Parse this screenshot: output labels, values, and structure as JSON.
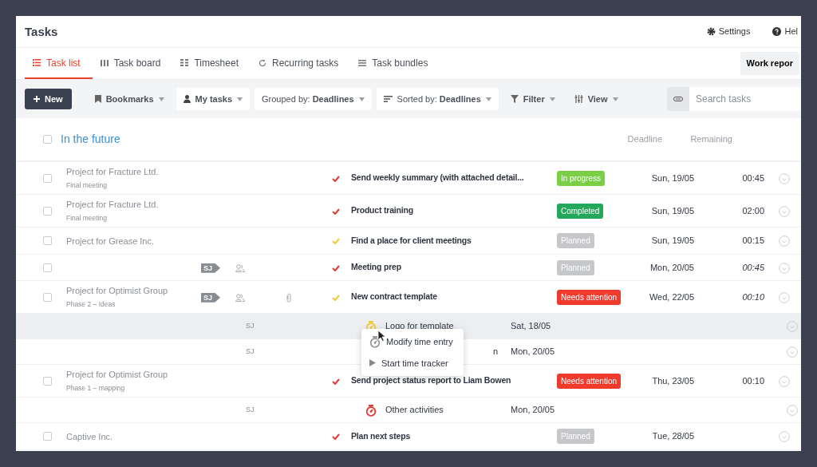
{
  "title": "Tasks",
  "header_links": [
    "Settings",
    "Hel"
  ],
  "tabs": [
    {
      "label": "Task list",
      "selected": true
    },
    {
      "label": "Task board",
      "selected": false
    },
    {
      "label": "Timesheet",
      "selected": false
    },
    {
      "label": "Recurring tasks",
      "selected": false
    },
    {
      "label": "Task bundles",
      "selected": false
    }
  ],
  "work_report_button": "Work repor",
  "toolbar": {
    "new_button": "New",
    "bookmarks": "Bookmarks",
    "my_tasks": "My tasks",
    "grouped_by": {
      "label": "Grouped by:",
      "value": "Deadlines"
    },
    "sorted_by": {
      "label": "Sorted by:",
      "value": "Deadlines"
    },
    "filter": "Filter",
    "view": "View",
    "search": {
      "placeholder": "Search tasks"
    }
  },
  "group": {
    "title": "In the future",
    "checked": false,
    "columns": [
      "Deadline",
      "Remaining"
    ]
  },
  "rows": [
    {
      "kind": "task",
      "checked": false,
      "project": "Project for Fracture Ltd.",
      "phase": "Final meeting",
      "shared": false,
      "attachment": false,
      "color": "#e53935",
      "title": "Send weekly summary (with attached detail...",
      "status": {
        "label": "In progress",
        "color": "#7bcf47"
      },
      "deadline": "Sun, 19/05",
      "remaining": "00:45",
      "estimated": false
    },
    {
      "kind": "task",
      "checked": false,
      "project": "Project for Fracture Ltd.",
      "phase": "Final meeting",
      "shared": false,
      "attachment": false,
      "color": "#e53935",
      "title": "Product training",
      "status": {
        "label": "Completed",
        "color": "#22a75b"
      },
      "deadline": "Sun, 19/05",
      "remaining": "02:00",
      "estimated": false
    },
    {
      "kind": "task",
      "checked": false,
      "project": "Project for Grease Inc.",
      "shared": false,
      "attachment": false,
      "color": "#f2c936",
      "title": "Find a place for client meetings",
      "status": {
        "label": "Planned",
        "color": "#c5c7cb"
      },
      "deadline": "Sun, 19/05",
      "remaining": "00:15",
      "estimated": false
    },
    {
      "kind": "task",
      "checked": false,
      "assignee": "SJ",
      "shared": true,
      "attachment": false,
      "color": "#e53935",
      "title": "Meeting prep",
      "status": {
        "label": "Planned",
        "color": "#c5c7cb"
      },
      "deadline": "Mon, 20/05",
      "remaining": "00:45",
      "estimated": true
    },
    {
      "kind": "task",
      "checked": false,
      "project": "Project for Optimist Group",
      "phase": "Phase 2 – Ideas",
      "assignee": "SJ",
      "shared": true,
      "attachment": true,
      "color": "#f2c936",
      "title": "New contract template",
      "status": {
        "label": "Needs attention",
        "color": "#f03a2c"
      },
      "deadline": "Wed, 22/05",
      "remaining": "00:10",
      "estimated": true
    },
    {
      "kind": "time_entry",
      "highlighted": true,
      "assignee": "SJ",
      "color": "#f2c936",
      "task": "Logo for template",
      "date": "Sat, 18/05"
    },
    {
      "kind": "time_entry",
      "highlighted": false,
      "assignee": "SJ",
      "task": "n",
      "date": "Mon, 20/05"
    },
    {
      "kind": "task",
      "checked": false,
      "project": "Project for Optimist Group",
      "phase": "Phase 1 – mapping",
      "shared": false,
      "attachment": false,
      "color": "#e53935",
      "title": "Send project status report to Liam Bowen",
      "status": {
        "label": "Needs attention",
        "color": "#f03a2c"
      },
      "deadline": "Thu, 23/05",
      "remaining": "00:10",
      "estimated": false
    },
    {
      "kind": "time_entry",
      "highlighted": false,
      "assignee": "SJ",
      "color": "#e53935",
      "task": "Other activities",
      "date": "Mon, 20/05"
    },
    {
      "kind": "task",
      "checked": false,
      "project": "Captive Inc.",
      "shared": false,
      "attachment": false,
      "color": "#e53935",
      "title": "Plan next steps",
      "status": {
        "label": "Planned",
        "color": "#c5c7cb"
      },
      "deadline": "Tue, 28/05"
    }
  ],
  "context_menu": [
    {
      "kind": "stopwatch",
      "label": "Modify time entry"
    },
    {
      "kind": "play",
      "label": "Start time tracker"
    }
  ]
}
